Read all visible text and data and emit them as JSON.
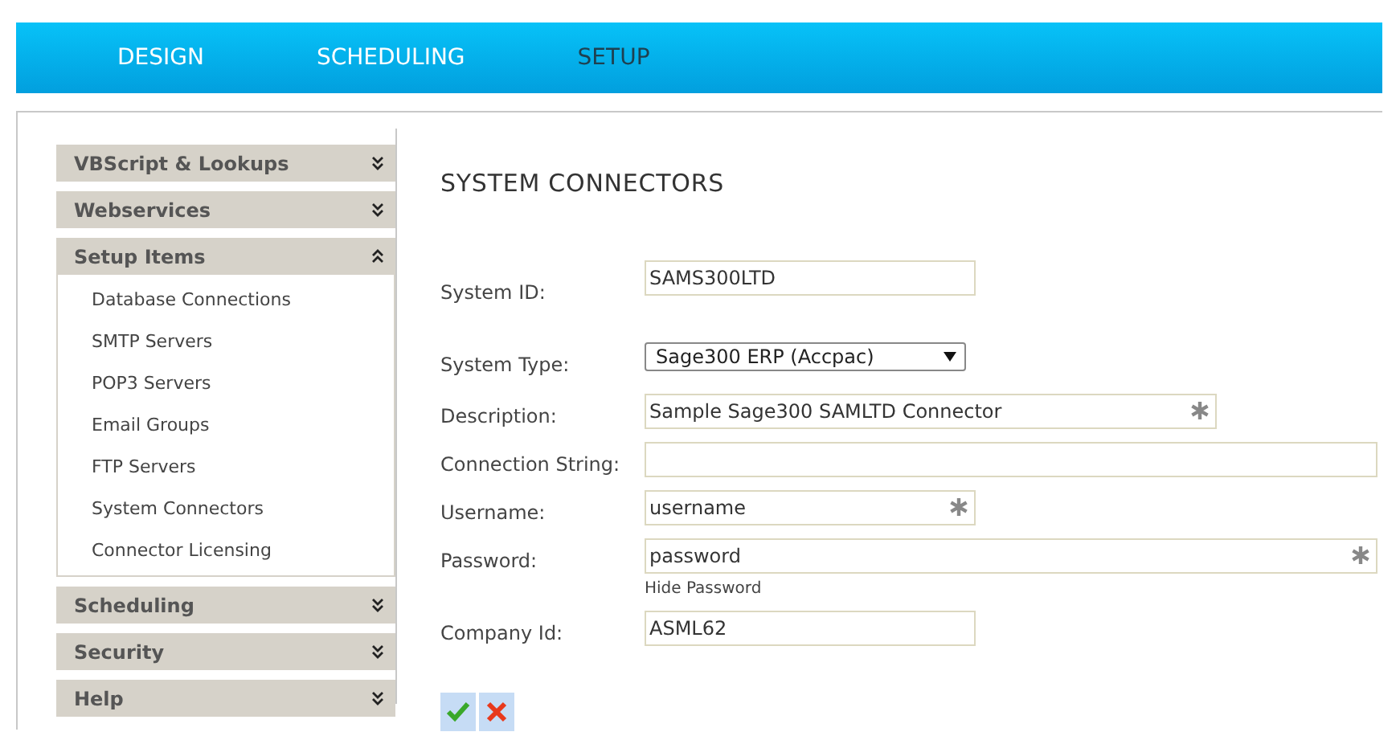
{
  "nav": [
    {
      "label": "DESIGN",
      "selected": false
    },
    {
      "label": "SCHEDULING",
      "selected": false
    },
    {
      "label": "SETUP",
      "selected": true
    }
  ],
  "sidebar": [
    {
      "label": "VBScript & Lookups",
      "expanded": false
    },
    {
      "label": "Webservices",
      "expanded": false
    },
    {
      "label": "Setup Items",
      "expanded": true,
      "items": [
        "Database Connections",
        "SMTP Servers",
        "POP3 Servers",
        "Email Groups",
        "FTP Servers",
        "System Connectors",
        "Connector Licensing"
      ]
    },
    {
      "label": "Scheduling",
      "expanded": false
    },
    {
      "label": "Security",
      "expanded": false
    },
    {
      "label": "Help",
      "expanded": false
    }
  ],
  "form": {
    "title": "SYSTEM CONNECTORS",
    "fields": [
      {
        "label": "System ID:",
        "kind": "text",
        "value": "SAMS300LTD",
        "required": false
      },
      {
        "label": "System Type:",
        "kind": "select",
        "value": "Sage300 ERP (Accpac)",
        "required": false
      },
      {
        "label": "Description:",
        "kind": "text",
        "value": "Sample Sage300 SAMLTD Connector",
        "required": true
      },
      {
        "label": "Connection String:",
        "kind": "text",
        "required": false
      },
      {
        "label": "Username:",
        "kind": "text",
        "value": "username",
        "required": true
      },
      {
        "label": "Password:",
        "kind": "text",
        "value": "password",
        "required": true,
        "link": "Hide Password"
      },
      {
        "label": "Company Id:",
        "kind": "text",
        "value": "ASML62",
        "required": false
      }
    ]
  }
}
